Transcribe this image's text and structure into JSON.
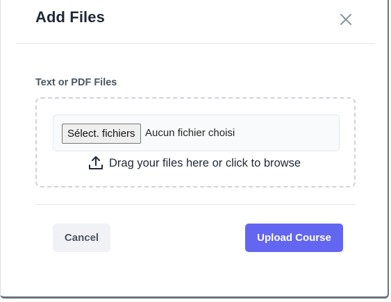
{
  "modal": {
    "title": "Add Files",
    "close_icon": "close-icon"
  },
  "upload": {
    "label": "Text or PDF Files",
    "select_button_label": "Sélect. fichiers",
    "file_status": "Aucun fichier choisi",
    "drag_hint": "Drag your files here or click to browse",
    "upload_icon": "upload-icon"
  },
  "footer": {
    "cancel_label": "Cancel",
    "submit_label": "Upload Course"
  },
  "colors": {
    "primary": "#6366f1",
    "cancel_background": "#f0f2f5",
    "title_text": "#1f2937",
    "dropzone_border": "#cfd3da"
  }
}
